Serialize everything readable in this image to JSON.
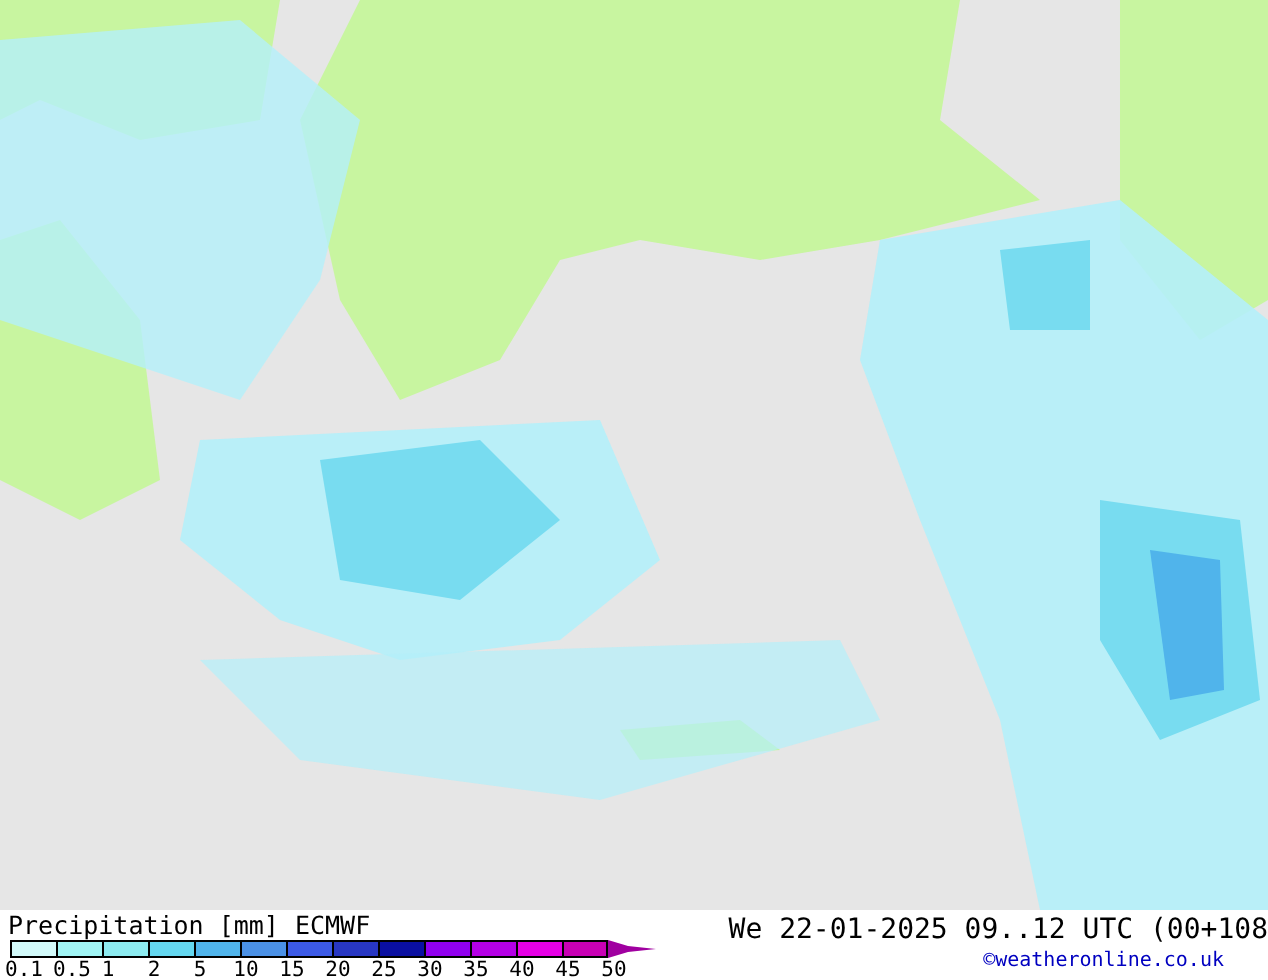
{
  "legend": {
    "title": "Precipitation [mm]",
    "model": "ECMWF",
    "swatches": [
      {
        "color": "#d2fafa"
      },
      {
        "color": "#a0f5f5"
      },
      {
        "color": "#8cebf0"
      },
      {
        "color": "#64d7f0"
      },
      {
        "color": "#50b4eb"
      },
      {
        "color": "#4b91e6"
      },
      {
        "color": "#3c5ae6"
      },
      {
        "color": "#2837c3"
      },
      {
        "color": "#0a0fa0"
      },
      {
        "color": "#9100f0"
      },
      {
        "color": "#b400e6"
      },
      {
        "color": "#e600e6"
      },
      {
        "color": "#c800b4"
      }
    ],
    "labels": [
      "0.1",
      "0.5",
      "1",
      "2",
      "5",
      "10",
      "15",
      "20",
      "25",
      "30",
      "35",
      "40",
      "45",
      "50"
    ]
  },
  "valid_time": "We 22-01-2025 09..12 UTC (00+108",
  "credit": "©weatheronline.co.uk"
}
